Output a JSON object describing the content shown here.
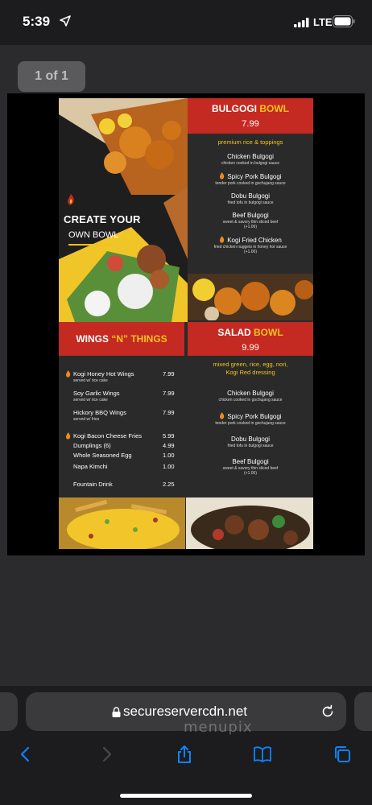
{
  "status_bar": {
    "time": "5:39",
    "network": "LTE"
  },
  "viewer": {
    "page_indicator": "1 of 1"
  },
  "menu": {
    "create_your": "CREATE YOUR",
    "own_bowl": "OWN BOWL",
    "bulgogi": {
      "title_1": "BULGOGI",
      "title_2": "BOWL",
      "price": "7.99",
      "subtitle": "premium rice & toppings",
      "items": [
        {
          "name": "Chicken Bulgogi",
          "desc": "chicken cooked in bulgogi sauce"
        },
        {
          "name": "Spicy Pork Bulgogi",
          "desc": "tender pork cooked in gochujang sauce"
        },
        {
          "name": "Dobu Bulgogi",
          "desc": "fried tofu in bulgogi sauce"
        },
        {
          "name": "Beef Bulgogi",
          "desc": "sweet & savory thin sliced beef",
          "extra": "(+1.00)"
        },
        {
          "name": "Kogi Fried Chicken",
          "desc": "fried chicken nuggets in honey hot sauce",
          "extra": "(+1.00)"
        }
      ]
    },
    "wings": {
      "title_1": "WINGS",
      "title_2": "“N”",
      "title_3": "THINGS",
      "items": [
        {
          "name": "Kogi Honey Hot Wings",
          "desc": "served w/ rice cake",
          "price": "7.99"
        },
        {
          "name": "Soy Garlic Wings",
          "desc": "served w/ rice cake",
          "price": "7.99"
        },
        {
          "name": "Hickory BBQ Wings",
          "desc": "served w/ fries",
          "price": "7.99"
        },
        {
          "name": "Kogi Bacon Cheese Fries",
          "price": "5.99"
        },
        {
          "name": "Dumplings (6)",
          "price": "4.99"
        },
        {
          "name": "Whole Seasoned Egg",
          "price": "1.00"
        },
        {
          "name": "Napa Kimchi",
          "price": "1.00"
        },
        {
          "name": "Fountain Drink",
          "price": "2.25"
        }
      ]
    },
    "salad": {
      "title_1": "SALAD",
      "title_2": "BOWL",
      "price": "9.99",
      "subtitle_1": "mixed green, rice, egg, nori,",
      "subtitle_2": "Kogi Red dressing",
      "items": [
        {
          "name": "Chicken Bulgogi",
          "desc": "chicken cooked in gochujang sauce"
        },
        {
          "name": "Spicy Pork Bulgogi",
          "desc": "tender pork cooked in gochujang sauce"
        },
        {
          "name": "Dobu Bulgogi",
          "desc": "fried tofu in bulgogi sauce"
        },
        {
          "name": "Beef Bulgogi",
          "desc": "sweet & savory thin sliced beef",
          "extra": "(+1.00)"
        }
      ]
    }
  },
  "browser": {
    "url": "secureservercdn.net"
  },
  "watermark": "menupix",
  "colors": {
    "banner_red": "#c42a22",
    "accent_yellow": "#f5c21b",
    "menu_bg": "#2a2a2a"
  }
}
